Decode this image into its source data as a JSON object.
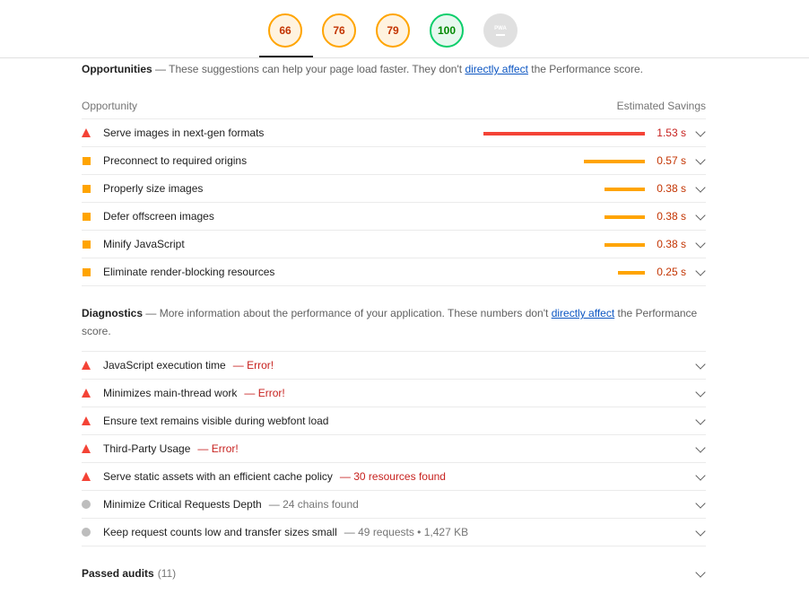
{
  "gauges": [
    {
      "value": "66",
      "status": "average"
    },
    {
      "value": "76",
      "status": "average"
    },
    {
      "value": "79",
      "status": "average"
    },
    {
      "value": "100",
      "status": "pass"
    },
    {
      "value": "PWA",
      "status": "not-applicable"
    }
  ],
  "colors": {
    "fail": "#f44336",
    "average": "#ffa400",
    "pass": "#0cce6b",
    "link": "#0b55c2"
  },
  "opportunities": {
    "title": "Opportunities",
    "desc_prefix": "— These suggestions can help your page load faster. They don't",
    "desc_link": "directly affect",
    "desc_suffix": "the Performance score.",
    "col_left": "Opportunity",
    "col_right": "Estimated Savings",
    "items": [
      {
        "title": "Serve images in next-gen formats",
        "savings": "1.53 s",
        "fraction": 0.9,
        "status": "fail"
      },
      {
        "title": "Preconnect to required origins",
        "savings": "0.57 s",
        "fraction": 0.34,
        "status": "average"
      },
      {
        "title": "Properly size images",
        "savings": "0.38 s",
        "fraction": 0.225,
        "status": "average"
      },
      {
        "title": "Defer offscreen images",
        "savings": "0.38 s",
        "fraction": 0.225,
        "status": "average"
      },
      {
        "title": "Minify JavaScript",
        "savings": "0.38 s",
        "fraction": 0.225,
        "status": "average"
      },
      {
        "title": "Eliminate render-blocking resources",
        "savings": "0.25 s",
        "fraction": 0.15,
        "status": "average"
      }
    ]
  },
  "diagnostics": {
    "title": "Diagnostics",
    "desc_prefix": "— More information about the performance of your application. These numbers don't",
    "desc_link": "directly affect",
    "desc_suffix": "the Performance score.",
    "items": [
      {
        "title": "JavaScript execution time",
        "detail": "— Error!",
        "status": "fail"
      },
      {
        "title": "Minimizes main-thread work",
        "detail": "— Error!",
        "status": "fail"
      },
      {
        "title": "Ensure text remains visible during webfont load",
        "detail": "",
        "status": "fail"
      },
      {
        "title": "Third-Party Usage",
        "detail": "— Error!",
        "status": "fail"
      },
      {
        "title": "Serve static assets with an efficient cache policy",
        "detail": "— 30 resources found",
        "status": "fail"
      },
      {
        "title": "Minimize Critical Requests Depth",
        "detail": "— 24 chains found",
        "status": "info"
      },
      {
        "title": "Keep request counts low and transfer sizes small",
        "detail": "— 49 requests • 1,427 KB",
        "status": "info"
      }
    ]
  },
  "passed": {
    "label": "Passed audits",
    "count": "(11)"
  }
}
